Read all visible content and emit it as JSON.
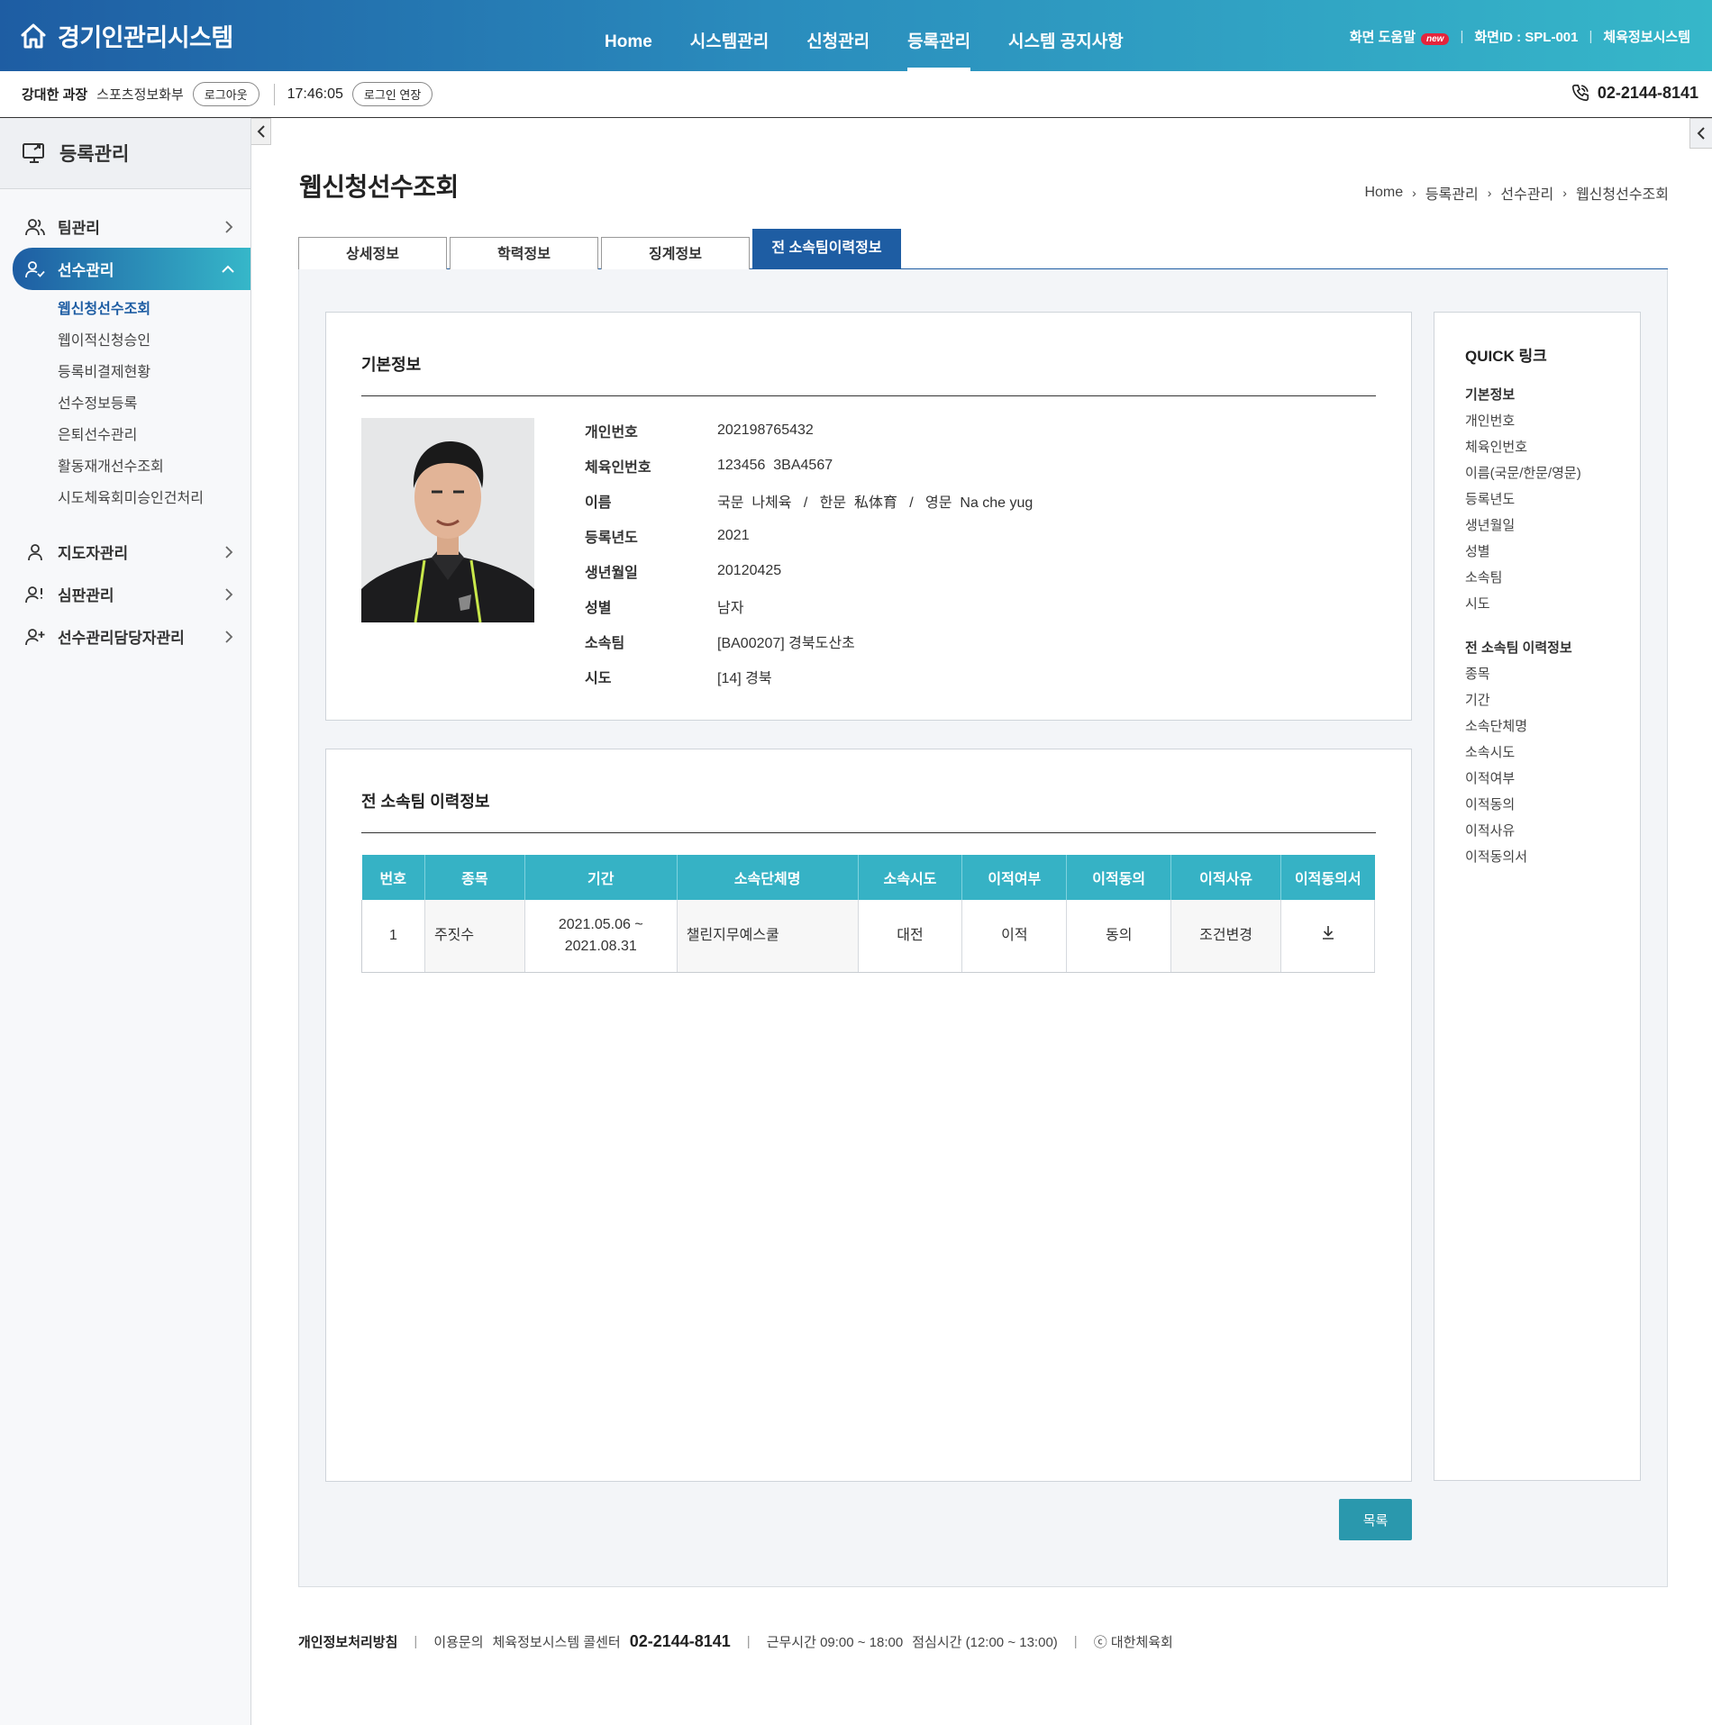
{
  "header": {
    "logo_text": "경기인관리시스템",
    "nav": [
      "Home",
      "시스템관리",
      "신청관리",
      "등록관리",
      "시스템 공지사항"
    ],
    "active_nav": "등록관리",
    "help_label": "화면 도움말",
    "new_badge": "new",
    "screen_id": "화면ID : SPL-001",
    "system_name": "체육정보시스템"
  },
  "userbar": {
    "user_name": "강대한 과장",
    "department": "스포츠정보화부",
    "logout_label": "로그아웃",
    "time": "17:46:05",
    "extend_label": "로그인 연장",
    "phone": "02-2144-8141"
  },
  "sidebar": {
    "title": "등록관리",
    "menu": [
      {
        "label": "팀관리",
        "icon": "users-icon"
      },
      {
        "label": "선수관리",
        "icon": "user-check-icon",
        "active": true,
        "children": [
          "웹신청선수조회",
          "웹이적신청승인",
          "등록비결제현황",
          "선수정보등록",
          "은퇴선수관리",
          "활동재개선수조회",
          "시도체육회미승인건처리"
        ],
        "current": "웹신청선수조회"
      },
      {
        "label": "지도자관리",
        "icon": "user-icon"
      },
      {
        "label": "심판관리",
        "icon": "user-alert-icon"
      },
      {
        "label": "선수관리담당자관리",
        "icon": "user-plus-icon"
      }
    ]
  },
  "page": {
    "title": "웹신청선수조회",
    "breadcrumb": [
      "Home",
      "등록관리",
      "선수관리",
      "웹신청선수조회"
    ]
  },
  "tabs": [
    "상세정보",
    "학력정보",
    "징계정보",
    "전 소속팀이력정보"
  ],
  "active_tab": "전 소속팀이력정보",
  "basic_info": {
    "title": "기본정보",
    "fields": [
      {
        "label": "개인번호",
        "value": "202198765432"
      },
      {
        "label": "체육인번호",
        "value": "123456  3BA4567"
      },
      {
        "label": "이름",
        "value": "국문  나체육   /   한문  私体育   /   영문  Na che yug"
      },
      {
        "label": "등록년도",
        "value": "2021"
      },
      {
        "label": "생년월일",
        "value": "20120425"
      },
      {
        "label": "성별",
        "value": "남자"
      },
      {
        "label": "소속팀",
        "value": "[BA00207] 경북도산초"
      },
      {
        "label": "시도",
        "value": "[14] 경북"
      }
    ]
  },
  "history": {
    "title": "전 소속팀 이력정보",
    "columns": [
      "번호",
      "종목",
      "기간",
      "소속단체명",
      "소속시도",
      "이적여부",
      "이적동의",
      "이적사유",
      "이적동의서"
    ],
    "rows": [
      {
        "no": "1",
        "sport": "주짓수",
        "period_start": "2021.05.06 ~",
        "period_end": "2021.08.31",
        "org": "챌린지무예스쿨",
        "region": "대전",
        "transfer": "이적",
        "consent": "동의",
        "reason": "조건변경",
        "doc_icon": "download-icon"
      }
    ]
  },
  "quick": {
    "title": "QUICK 링크",
    "groups": [
      {
        "heading": "기본정보",
        "links": [
          "개인번호",
          "체육인번호",
          "이름(국문/한문/영문)",
          "등록년도",
          "생년월일",
          "성별",
          "소속팀",
          "시도"
        ]
      },
      {
        "heading": "전 소속팀 이력정보",
        "links": [
          "종목",
          "기간",
          "소속단체명",
          "소속시도",
          "이적여부",
          "이적동의",
          "이적사유",
          "이적동의서"
        ]
      }
    ]
  },
  "list_button": "목록",
  "footer": {
    "privacy": "개인정보처리방침",
    "inquiry": "이용문의",
    "callcenter": "체육정보시스템 콜센터",
    "phone": "02-2144-8141",
    "hours": "근무시간 09:00 ~ 18:00",
    "lunch": "점심시간 (12:00 ~ 13:00)",
    "copyright": "ⓒ 대한체육회"
  },
  "colors": {
    "primary": "#1e5da3",
    "accent": "#36b2c5",
    "button": "#2a98ad",
    "new_badge": "#e5243b"
  }
}
